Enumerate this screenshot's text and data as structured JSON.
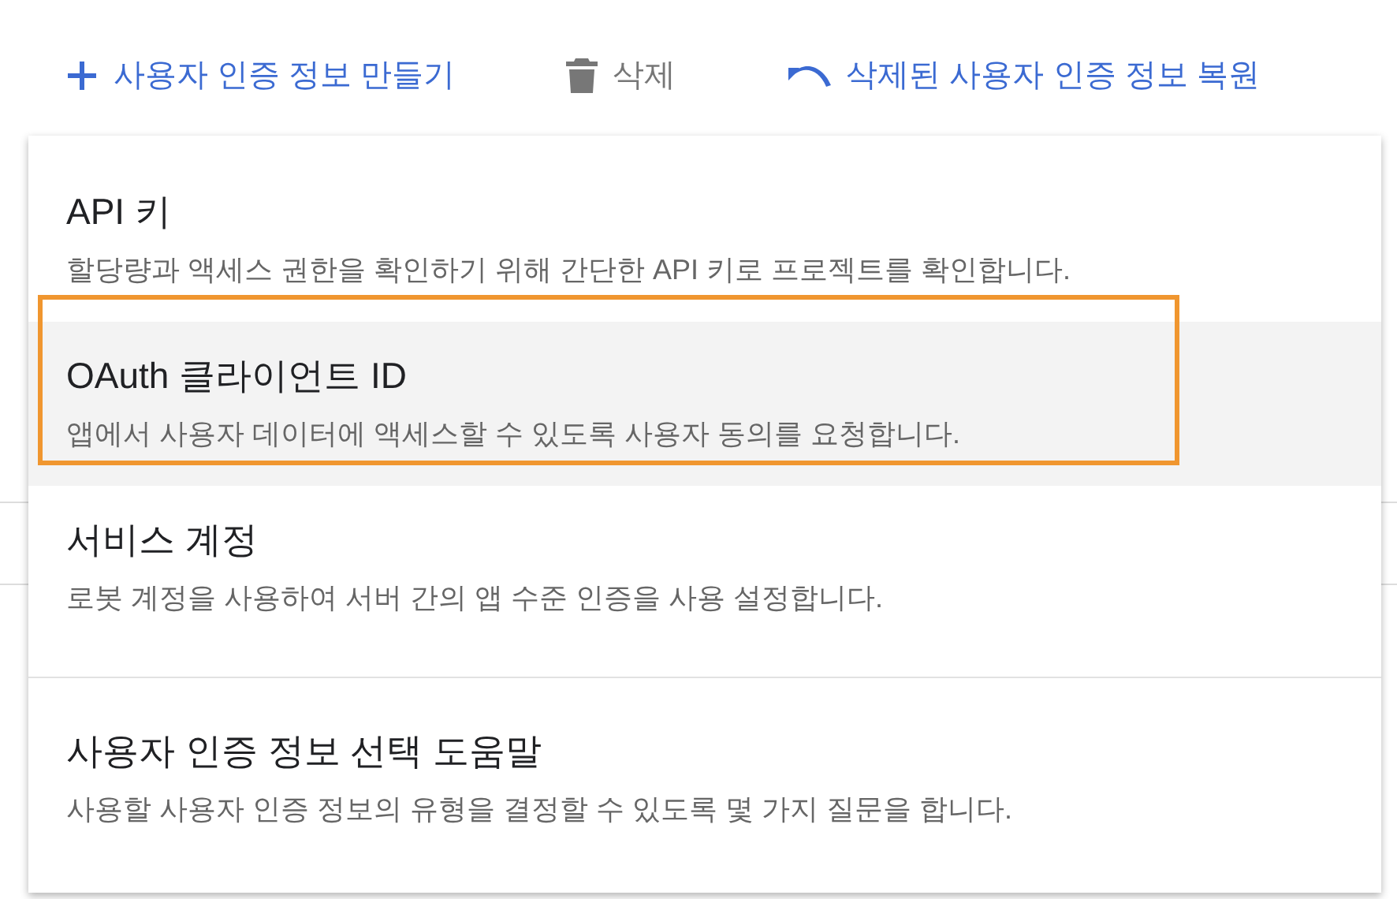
{
  "toolbar": [
    {
      "kind": "create",
      "label": "사용자 인증 정보 만들기",
      "disabled": false
    },
    {
      "kind": "delete",
      "label": "삭제",
      "disabled": true
    },
    {
      "kind": "restore",
      "label": "삭제된 사용자 인증 정보 복원",
      "disabled": false
    }
  ],
  "menu": {
    "items": [
      {
        "kind": "option",
        "title": "API 키",
        "description": "할당량과 액세스 권한을 확인하기 위해 간단한 API 키로 프로젝트를 확인합니다.",
        "hovered": false,
        "highlighted": false
      },
      {
        "kind": "option",
        "title": "OAuth 클라이언트 ID",
        "description": "앱에서 사용자 데이터에 액세스할 수 있도록 사용자 동의를 요청합니다.",
        "hovered": true,
        "highlighted": true
      },
      {
        "kind": "option",
        "title": "서비스 계정",
        "description": "로봇 계정을 사용하여 서버 간의 앱 수준 인증을 사용 설정합니다.",
        "hovered": false,
        "highlighted": false
      },
      {
        "kind": "help",
        "title": "사용자 인증 정보 선택 도움말",
        "description": "사용할 사용자 인증 정보의 유형을 결정할 수 있도록 몇 가지 질문을 합니다.",
        "hovered": false,
        "highlighted": false
      }
    ]
  }
}
